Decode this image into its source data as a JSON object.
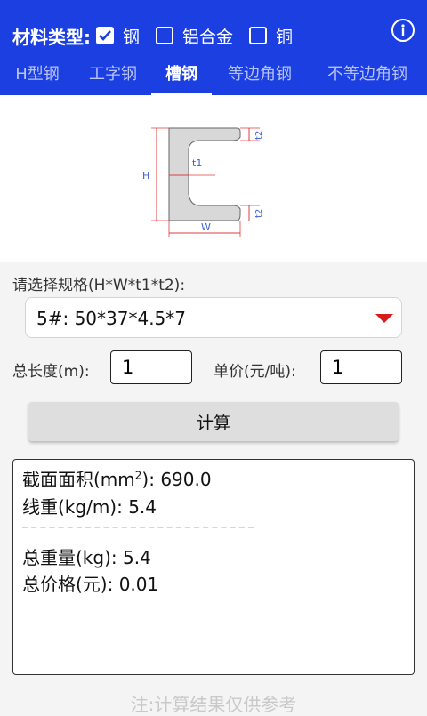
{
  "header": {
    "material_label": "材料类型:",
    "materials": [
      {
        "label": "钢",
        "checked": true
      },
      {
        "label": "铝合金",
        "checked": false
      },
      {
        "label": "铜",
        "checked": false
      }
    ],
    "info_icon": "info-circle-icon",
    "accent_color": "#1c3fe2"
  },
  "tabs": [
    {
      "label": "H型钢",
      "active": false
    },
    {
      "label": "工字钢",
      "active": false
    },
    {
      "label": "槽钢",
      "active": true
    },
    {
      "label": "等边角钢",
      "active": false
    },
    {
      "label": "不等边角钢",
      "active": false
    }
  ],
  "diagram": {
    "labels": {
      "h": "H",
      "w": "W",
      "t1": "t1",
      "t2": "t2"
    }
  },
  "spec": {
    "label": "请选择规格(H*W*t1*t2):",
    "value": "5#:  50*37*4.5*7",
    "arrow_color": "#d71a1a"
  },
  "inputs": {
    "length_label": "总长度(m):",
    "length_value": "1",
    "price_label": "单价(元/吨):",
    "price_value": "1"
  },
  "calc_button": "计算",
  "results": {
    "area_label": "截面面积(mm",
    "area_sup": "2",
    "area_rest": "):  690.0",
    "linear_weight": "线重(kg/m):  5.4",
    "total_weight": "总重量(kg):  5.4",
    "total_price": "总价格(元):  0.01"
  },
  "note": "注:计算结果仅供参考"
}
